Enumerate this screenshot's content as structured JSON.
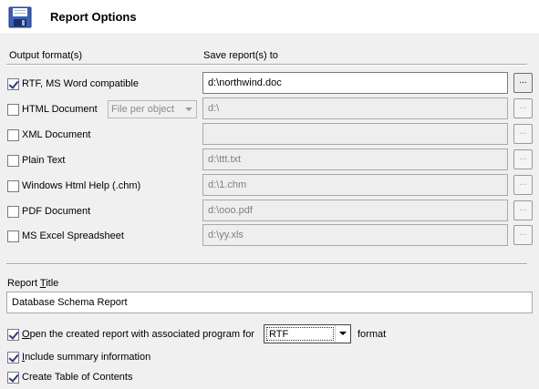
{
  "header": {
    "title": "Report Options",
    "icon": "floppy-disk-icon"
  },
  "columns": {
    "output_formats": "Output format(s)",
    "save_to": "Save report(s) to"
  },
  "formats": [
    {
      "label": "RTF, MS Word compatible",
      "checked": true,
      "path": "d:\\northwind.doc",
      "enabled": true
    },
    {
      "label": "HTML Document",
      "checked": false,
      "path": "d:\\",
      "enabled": false
    },
    {
      "label": "XML Document",
      "checked": false,
      "path": "",
      "enabled": false
    },
    {
      "label": "Plain Text",
      "checked": false,
      "path": "d:\\ttt.txt",
      "enabled": false
    },
    {
      "label": "Windows Html Help (.chm)",
      "checked": false,
      "path": "d:\\1.chm",
      "enabled": false
    },
    {
      "label": "PDF Document",
      "checked": false,
      "path": "d:\\ooo.pdf",
      "enabled": false
    },
    {
      "label": "MS Excel Spreadsheet",
      "checked": false,
      "path": "d:\\yy.xls",
      "enabled": false
    }
  ],
  "browse_label": "...",
  "html_mode": {
    "selected": "File per object"
  },
  "report_title": {
    "label_pre": "Report ",
    "label_underlined": "T",
    "label_post": "itle",
    "value": "Database Schema Report"
  },
  "options": {
    "open_report": {
      "checked": true,
      "underlined": "O",
      "rest": "pen the created report with associated program for"
    },
    "open_format": "RTF",
    "format_suffix": "format",
    "include_summary": {
      "checked": true,
      "underlined": "I",
      "rest": "nclude summary information"
    },
    "create_toc": {
      "checked": true,
      "underlined": "",
      "rest": "Create Table of Contents"
    }
  },
  "colors": {
    "check": "#2a3a8a",
    "disabled_text": "#808080"
  }
}
